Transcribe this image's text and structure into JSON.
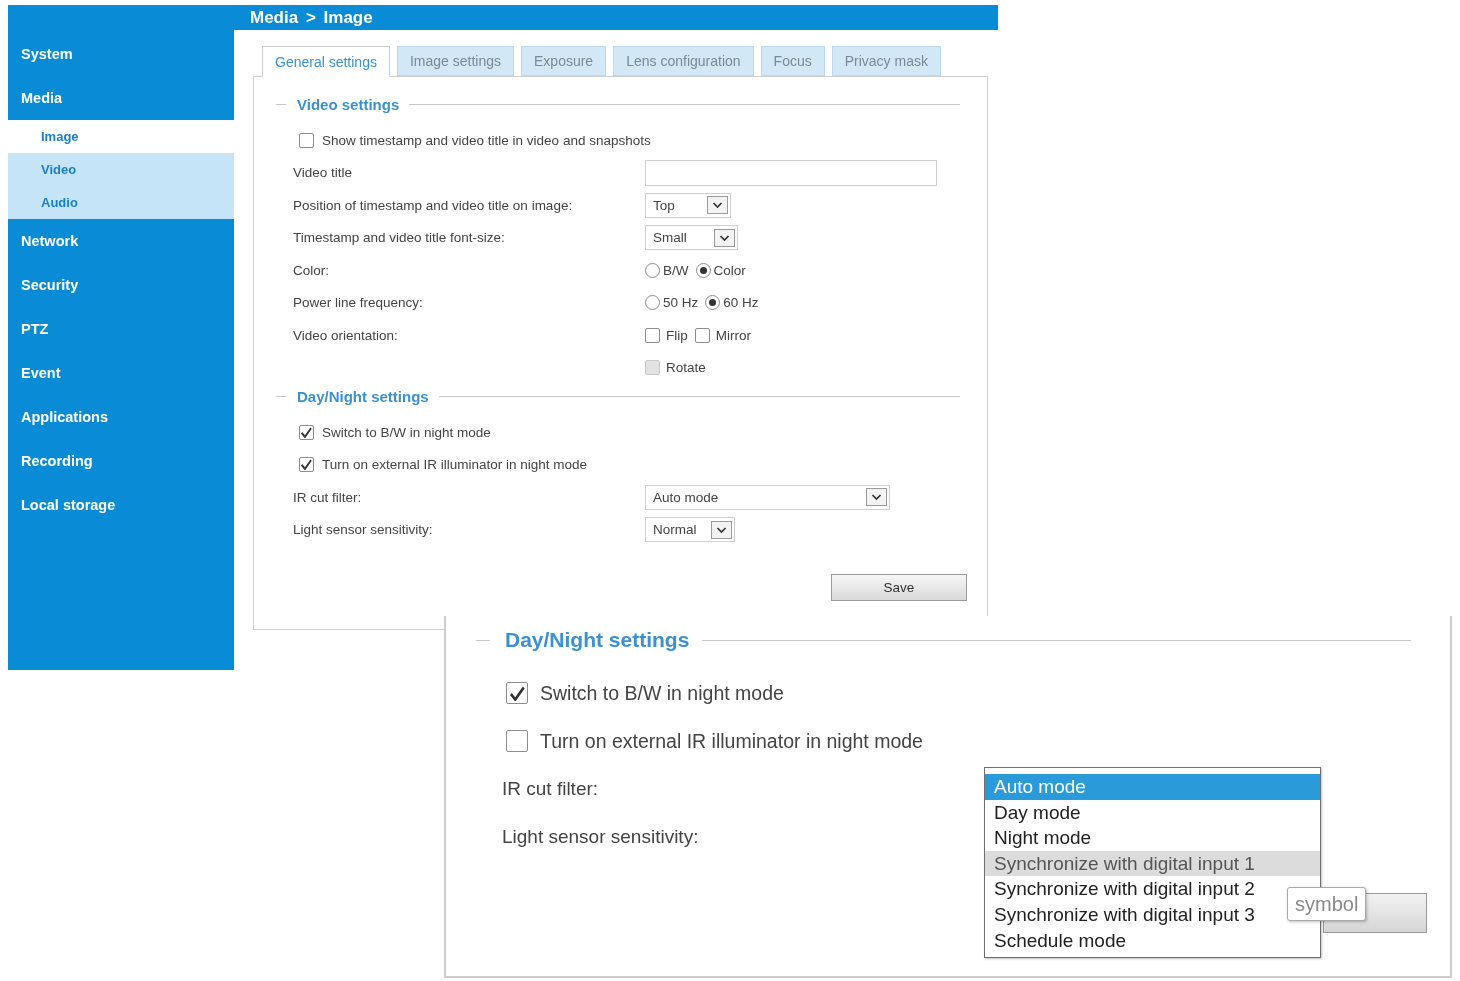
{
  "header": {
    "breadcrumb": "Media > Image"
  },
  "sidebar": {
    "items": [
      {
        "label": "System"
      },
      {
        "label": "Media",
        "children": [
          {
            "label": "Image",
            "selected": true
          },
          {
            "label": "Video",
            "selected": false
          },
          {
            "label": "Audio",
            "selected": false
          }
        ]
      },
      {
        "label": "Network"
      },
      {
        "label": "Security"
      },
      {
        "label": "PTZ"
      },
      {
        "label": "Event"
      },
      {
        "label": "Applications"
      },
      {
        "label": "Recording"
      },
      {
        "label": "Local storage"
      }
    ]
  },
  "tabs": [
    {
      "label": "General settings",
      "selected": true
    },
    {
      "label": "Image settings",
      "selected": false
    },
    {
      "label": "Exposure",
      "selected": false
    },
    {
      "label": "Lens configuration",
      "selected": false
    },
    {
      "label": "Focus",
      "selected": false
    },
    {
      "label": "Privacy mask",
      "selected": false
    }
  ],
  "video_settings": {
    "title": "Video settings",
    "rows": [
      {
        "kind": "checkbox",
        "label": "Show timestamp and video title in video and snapshots",
        "checked": false
      },
      {
        "kind": "input",
        "label": "Video title"
      },
      {
        "kind": "select",
        "label": "Position of timestamp and video title on image:",
        "value": "Top"
      },
      {
        "kind": "select",
        "label": "Timestamp and video title font-size:",
        "value": "Small"
      },
      {
        "kind": "radios",
        "label": "Color:",
        "options": [
          {
            "label": "B/W",
            "selected": false
          },
          {
            "label": "Color",
            "selected": true
          }
        ]
      },
      {
        "kind": "radios",
        "label": "Power line frequency:",
        "options": [
          {
            "label": "50 Hz",
            "selected": false
          },
          {
            "label": "60 Hz",
            "selected": true
          }
        ]
      },
      {
        "kind": "checkboxes",
        "label": "Video orientation:",
        "options": [
          {
            "label": "Flip",
            "checked": false,
            "disabled": false
          },
          {
            "label": "Mirror",
            "checked": false,
            "disabled": false
          }
        ]
      },
      {
        "kind": "checkboxes",
        "options": [
          {
            "label": "Rotate",
            "checked": false,
            "disabled": true
          }
        ]
      }
    ]
  },
  "day_night_settings": {
    "title": "Day/Night settings",
    "rows": [
      {
        "kind": "checkbox",
        "label": "Switch to B/W in night mode",
        "checked": true
      },
      {
        "kind": "checkbox",
        "label": "Turn on external IR illuminator in night mode",
        "checked": true
      },
      {
        "kind": "select",
        "label": "IR cut filter:",
        "value": "Auto mode"
      },
      {
        "kind": "select",
        "label": "Light sensor sensitivity:",
        "value": "Normal"
      }
    ]
  },
  "save_button": "Save",
  "zoomed_view": {
    "title": "Day/Night settings",
    "rows": [
      {
        "kind": "checkbox",
        "label": "Switch to B/W in night mode",
        "checked": true
      },
      {
        "kind": "checkbox",
        "label": "Turn on external IR illuminator in night mode",
        "checked": false
      },
      {
        "kind": "label",
        "label": "IR cut filter:"
      },
      {
        "kind": "label",
        "label": "Light sensor sensitivity:"
      }
    ],
    "ir_cut_filter_options": [
      {
        "label": "Auto mode",
        "selected": true,
        "hovered": false
      },
      {
        "label": "Day mode",
        "selected": false,
        "hovered": false
      },
      {
        "label": "Night mode",
        "selected": false,
        "hovered": false
      },
      {
        "label": "Synchronize with digital input 1",
        "selected": false,
        "hovered": true
      },
      {
        "label": "Synchronize with digital input 2",
        "selected": false,
        "hovered": false
      },
      {
        "label": "Synchronize with digital input 3",
        "selected": false,
        "hovered": false
      },
      {
        "label": "Schedule mode",
        "selected": false,
        "hovered": false
      }
    ],
    "tooltip": "symbol"
  }
}
